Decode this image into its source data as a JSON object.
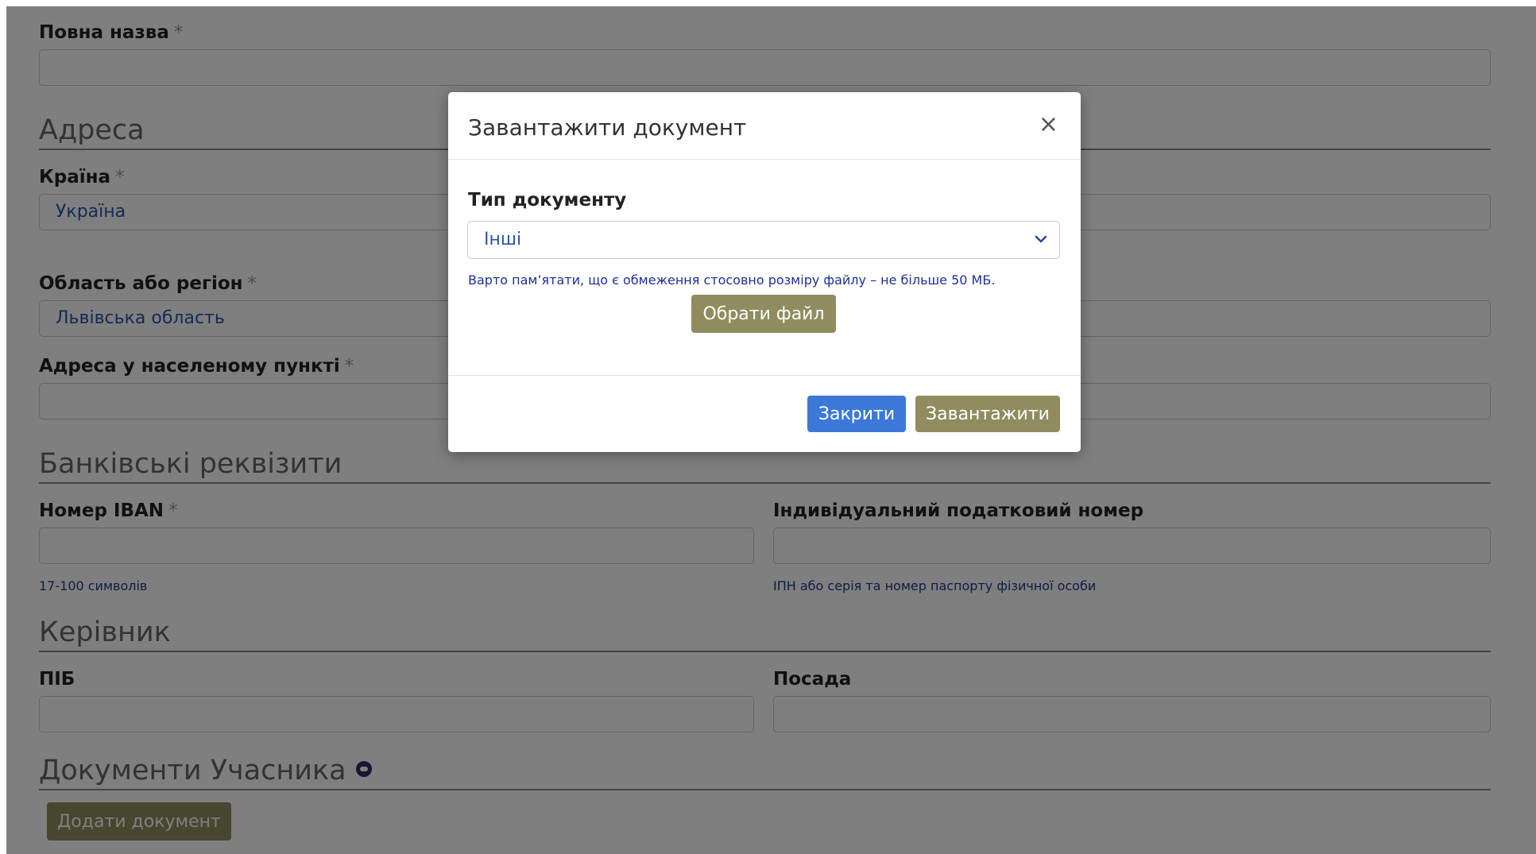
{
  "form": {
    "full_name": {
      "label": "Повна назва",
      "required_mark": "*",
      "value": ""
    },
    "address_section": "Адреса",
    "country": {
      "label": "Країна",
      "required_mark": "*",
      "value": "Україна"
    },
    "region": {
      "label": "Область або регіон",
      "required_mark": "*",
      "value": "Львівська область"
    },
    "street_address": {
      "label": "Адреса у населеному пункті",
      "required_mark": "*",
      "value": ""
    },
    "bank_section": "Банківські реквізити",
    "iban": {
      "label": "Номер IBAN",
      "required_mark": "*",
      "value": "",
      "hint": "17-100 символів"
    },
    "tax_id": {
      "label": "Індивідуальний податковий номер",
      "value": "",
      "hint": "ІПН або серія та номер паспорту фізичної особи"
    },
    "manager_section": "Керівник",
    "manager_name": {
      "label": "ПІБ",
      "value": ""
    },
    "manager_position": {
      "label": "Посада",
      "value": ""
    },
    "documents_section": "Документи Учасника",
    "documents_info_icon": "info-icon",
    "add_document_label": "Додати документ"
  },
  "modal": {
    "title": "Завантажити документ",
    "close_symbol": "×",
    "doc_type_label": "Тип документу",
    "doc_type_value": "Інші",
    "size_note": "Варто пам’ятати, що є обмеження стосовно розміру файлу – не більше 50 МБ.",
    "choose_file_label": "Обрати файл",
    "close_label": "Закрити",
    "upload_label": "Завантажити"
  },
  "colors": {
    "overlay": "#808080",
    "olive_button": "#8f8d5f",
    "blue_button": "#3b78d8",
    "link_text": "#2a55a8"
  }
}
